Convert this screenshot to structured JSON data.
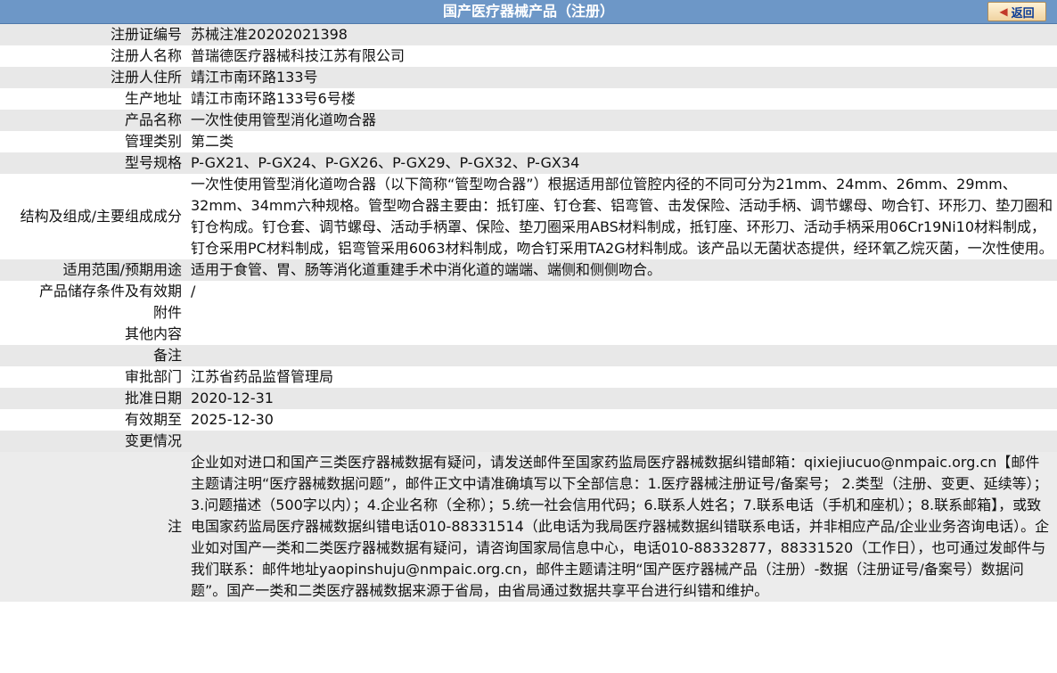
{
  "header": {
    "title": "国产医疗器械产品（注册）",
    "back_label": "返回"
  },
  "rows": [
    {
      "label": "注册证编号",
      "value": "苏械注准20202021398"
    },
    {
      "label": "注册人名称",
      "value": "普瑞德医疗器械科技江苏有限公司"
    },
    {
      "label": "注册人住所",
      "value": "靖江市南环路133号"
    },
    {
      "label": "生产地址",
      "value": "靖江市南环路133号6号楼"
    },
    {
      "label": "产品名称",
      "value": "一次性使用管型消化道吻合器"
    },
    {
      "label": "管理类别",
      "value": "第二类"
    },
    {
      "label": "型号规格",
      "value": "P-GX21、P-GX24、P-GX26、P-GX29、P-GX32、P-GX34"
    },
    {
      "label": "结构及组成/主要组成成分",
      "value": "一次性使用管型消化道吻合器（以下简称“管型吻合器”）根据适用部位管腔内径的不同可分为21mm、24mm、26mm、29mm、32mm、34mm六种规格。管型吻合器主要由：抵钉座、钉仓套、铝弯管、击发保险、活动手柄、调节螺母、吻合钉、环形刀、垫刀圈和钉仓构成。钉仓套、调节螺母、活动手柄罩、保险、垫刀圈采用ABS材料制成，抵钉座、环形刀、活动手柄采用06Cr19Ni10材料制成，钉仓采用PC材料制成，铝弯管采用6063材料制成，吻合钉采用TA2G材料制成。该产品以无菌状态提供，经环氧乙烷灭菌，一次性使用。"
    },
    {
      "label": "适用范围/预期用途",
      "value": "适用于食管、胃、肠等消化道重建手术中消化道的端端、端侧和侧侧吻合。"
    },
    {
      "label": "产品储存条件及有效期",
      "value": "/"
    },
    {
      "label": "附件",
      "value": ""
    },
    {
      "label": "其他内容",
      "value": ""
    },
    {
      "label": "备注",
      "value": ""
    },
    {
      "label": "审批部门",
      "value": "江苏省药品监督管理局"
    },
    {
      "label": "批准日期",
      "value": "2020-12-31"
    },
    {
      "label": "有效期至",
      "value": "2025-12-30"
    },
    {
      "label": "变更情况",
      "value": ""
    }
  ],
  "notes": {
    "label": "注",
    "value": "企业如对进口和国产三类医疗器械数据有疑问，请发送邮件至国家药监局医疗器械数据纠错邮箱：qixiejiucuo@nmpaic.org.cn【邮件主题请注明“医疗器械数据问题”，邮件正文中请准确填写以下全部信息：1.医疗器械注册证号/备案号； 2.类型（注册、变更、延续等）；3.问题描述（500字以内）；4.企业名称（全称）；5.统一社会信用代码；6.联系人姓名；7.联系电话（手机和座机）；8.联系邮箱】，或致电国家药监局医疗器械数据纠错电话010-88331514（此电话为我局医疗器械数据纠错联系电话，并非相应产品/企业业务咨询电话）。企业如对国产一类和二类医疗器械数据有疑问，请咨询国家局信息中心，电话010-88332877，88331520（工作日），也可通过发邮件与我们联系：邮件地址yaopinshuju@nmpaic.org.cn，邮件主题请注明“国产医疗器械产品（注册）-数据（注册证号/备案号）数据问题”。国产一类和二类医疗器械数据来源于省局，由省局通过数据共享平台进行纠错和维护。"
  },
  "colors": {
    "header_bg": "#6d97c7",
    "row_shade": "#e8e8e8",
    "back_text": "#0b3c96"
  }
}
